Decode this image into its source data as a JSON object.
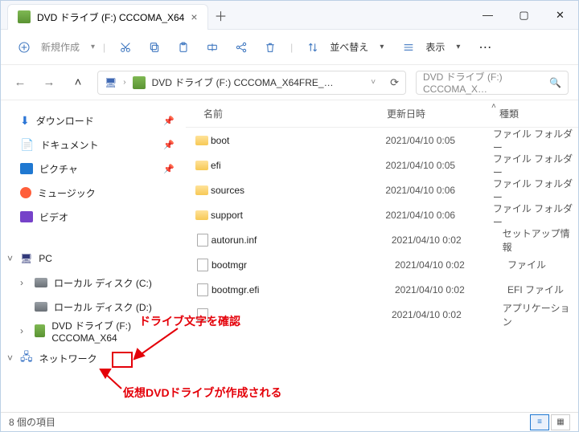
{
  "window": {
    "tab_title": "DVD ドライブ (F:) CCCOMA_X64",
    "min": "―",
    "max": "▢",
    "close": "✕",
    "newtab": "＋"
  },
  "toolbar": {
    "new_label": "新規作成",
    "sort_label": "並べ替え",
    "view_label": "表示"
  },
  "nav": {
    "breadcrumb": "DVD ドライブ (F:) CCCOMA_X64FRE_…",
    "search_placeholder": "DVD ドライブ (F:) CCCOMA_X…"
  },
  "sidebar": {
    "quick": [
      {
        "label": "ダウンロード"
      },
      {
        "label": "ドキュメント"
      },
      {
        "label": "ピクチャ"
      },
      {
        "label": "ミュージック"
      },
      {
        "label": "ビデオ"
      }
    ],
    "pc_label": "PC",
    "disks": [
      {
        "label": "ローカル ディスク (C:)"
      },
      {
        "label": "ローカル ディスク (D:)"
      },
      {
        "label": "DVD ドライブ (F:) CCCOMA_X64"
      }
    ],
    "network_label": "ネットワーク"
  },
  "columns": {
    "name": "名前",
    "date": "更新日時",
    "type": "種類"
  },
  "files": [
    {
      "name": "boot",
      "date": "2021/04/10  0:05",
      "type": "ファイル フォルダー",
      "kind": "folder"
    },
    {
      "name": "efi",
      "date": "2021/04/10  0:05",
      "type": "ファイル フォルダー",
      "kind": "folder"
    },
    {
      "name": "sources",
      "date": "2021/04/10  0:06",
      "type": "ファイル フォルダー",
      "kind": "folder"
    },
    {
      "name": "support",
      "date": "2021/04/10  0:06",
      "type": "ファイル フォルダー",
      "kind": "folder"
    },
    {
      "name": "autorun.inf",
      "date": "2021/04/10  0:02",
      "type": "セットアップ情報",
      "kind": "file"
    },
    {
      "name": "bootmgr",
      "date": "2021/04/10  0:02",
      "type": "ファイル",
      "kind": "file"
    },
    {
      "name": "bootmgr.efi",
      "date": "2021/04/10  0:02",
      "type": "EFI ファイル",
      "kind": "file"
    },
    {
      "name": "",
      "date": "2021/04/10  0:02",
      "type": "アプリケーション",
      "kind": "file"
    }
  ],
  "status": {
    "count": "8 個の項目"
  },
  "annotations": {
    "a1": "ドライブ文字を確認",
    "a2": "仮想DVDドライブが作成される"
  }
}
